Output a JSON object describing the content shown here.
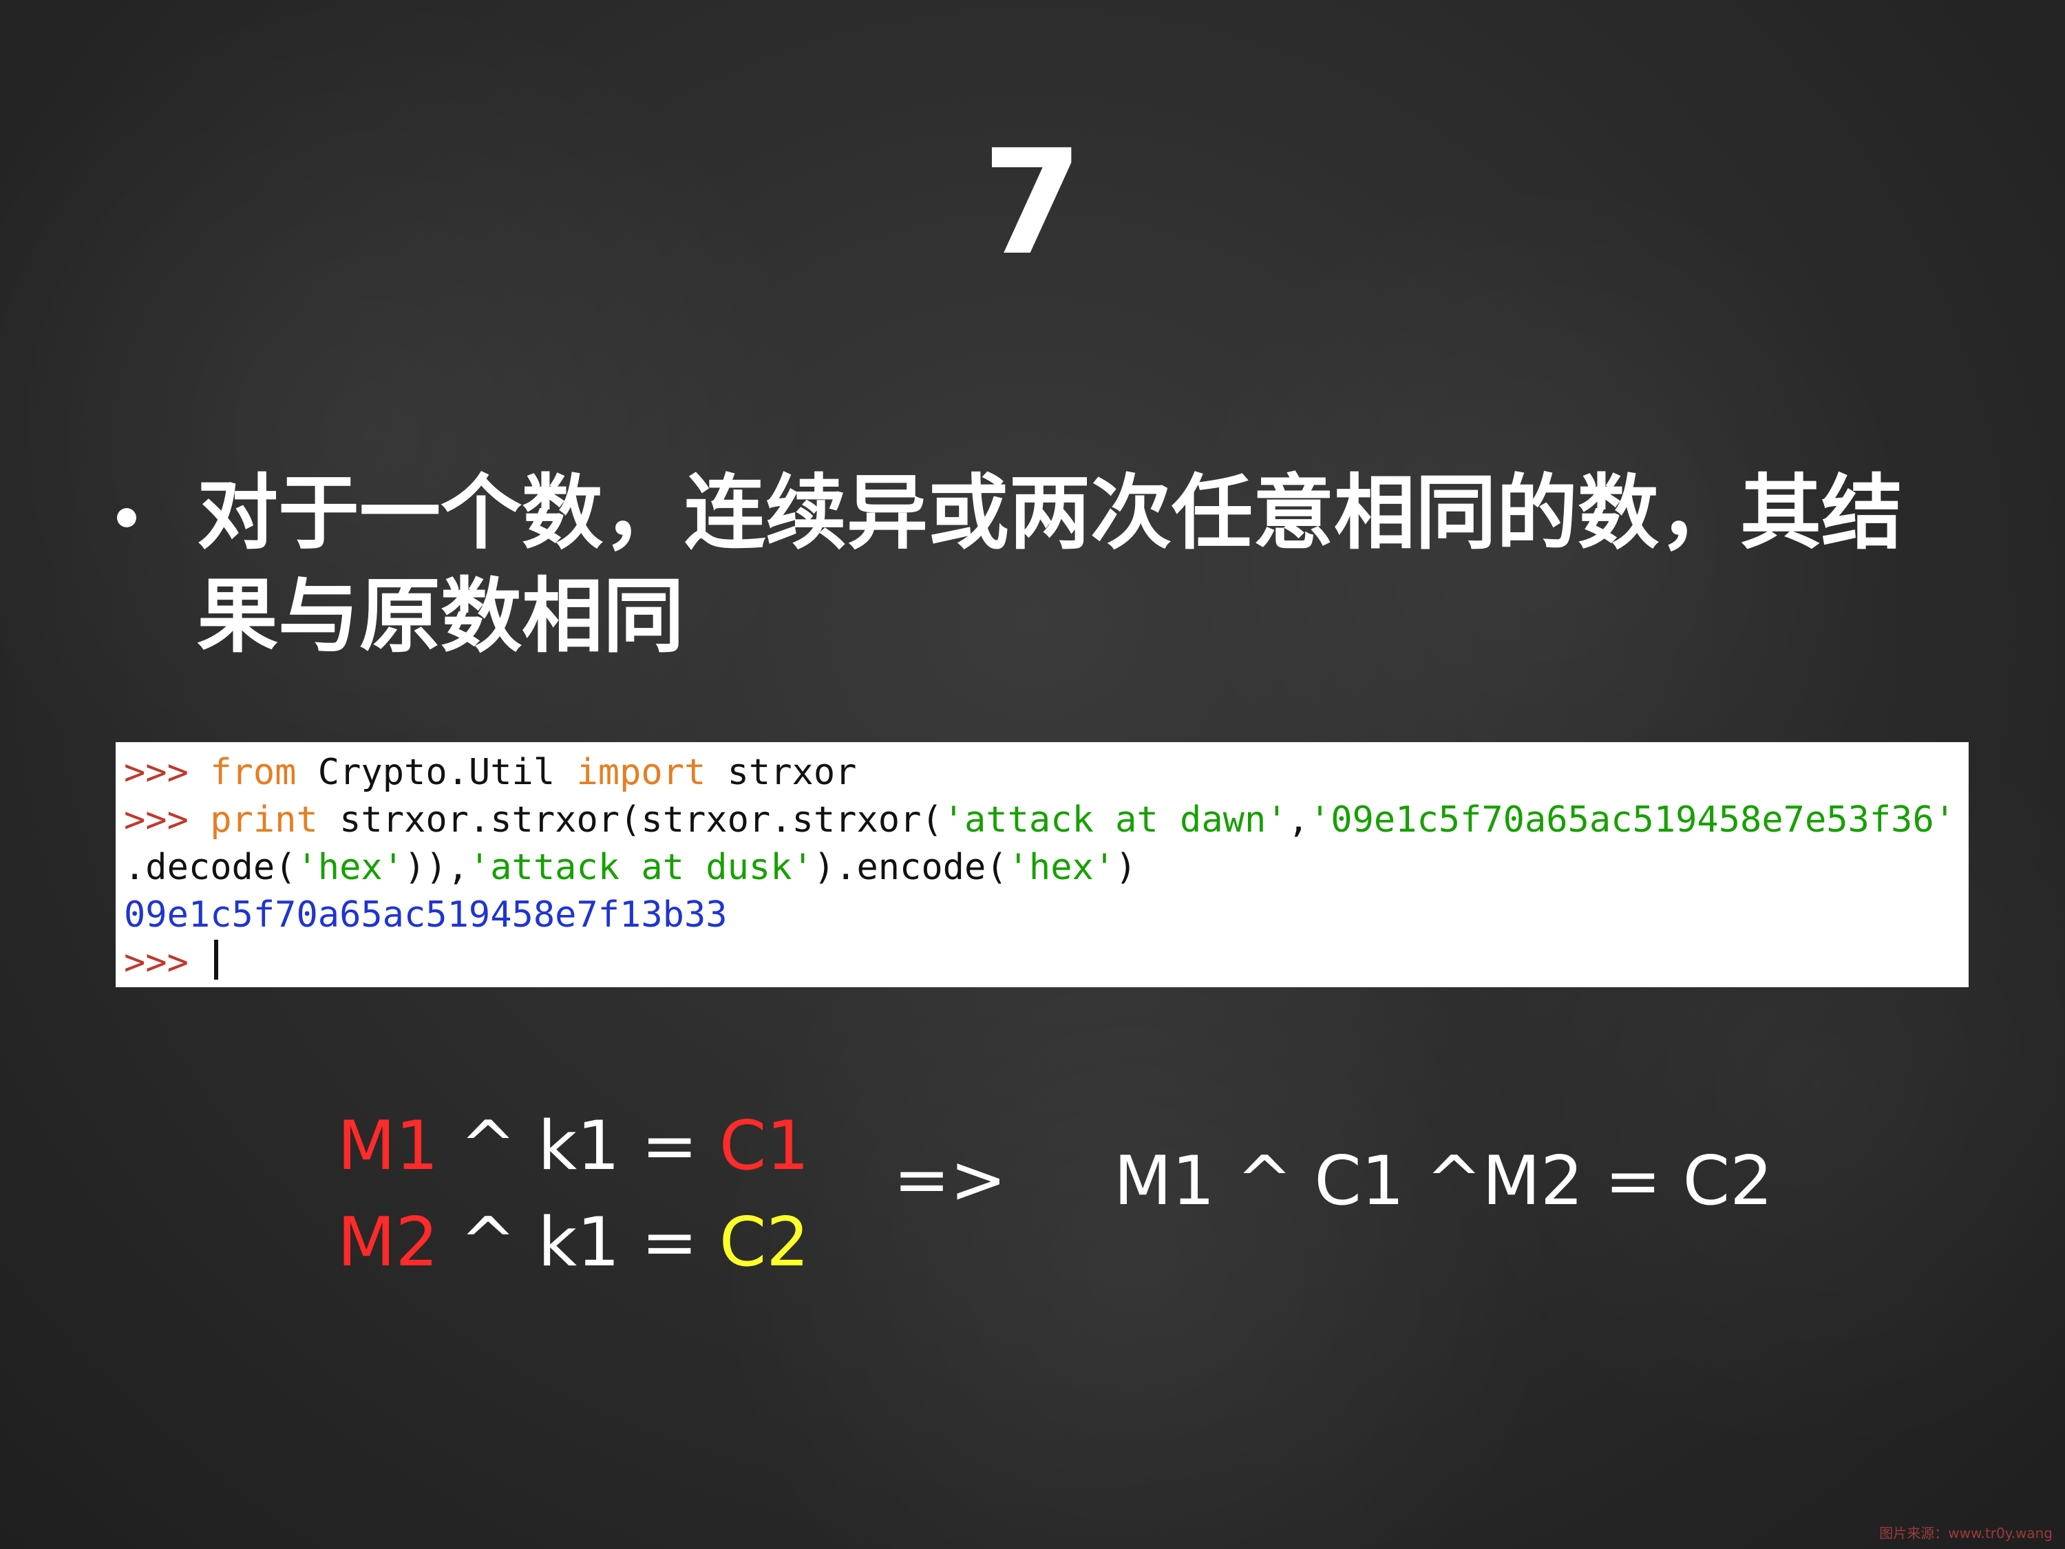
{
  "slide": {
    "title": "7",
    "bullet": "对于一个数，连续异或两次任意相同的数，其结果与原数相同"
  },
  "code": {
    "prompt": ">>>",
    "line1": {
      "from": "from",
      "module": "Crypto.Util",
      "import": "import",
      "name": "strxor"
    },
    "line2": {
      "print": "print",
      "call": "strxor.strxor(strxor.strxor(",
      "str1": "'attack at dawn'",
      "comma": ",",
      "str2": "'09e1c5f70a65ac519458e7e53f36'"
    },
    "line3": {
      "decode": ".decode(",
      "hex1": "'hex'",
      "close1": ")),",
      "str3": "'attack at dusk'",
      "encode": ").encode(",
      "hex2": "'hex'",
      "close2": ")"
    },
    "output": "09e1c5f70a65ac519458e7f13b33"
  },
  "formula": {
    "row1": {
      "m": "M1",
      "mid": " ^ k1 = ",
      "c": "C1"
    },
    "row2": {
      "m": "M2",
      "mid": " ^ k1 = ",
      "c": "C2"
    },
    "arrow": "=>",
    "result": "M1 ^ C1 ^M2 = C2"
  },
  "colors": {
    "background": "#2d2d2d",
    "red": "#ff2a2a",
    "yellow": "#ffff2a",
    "code_green": "#17a000",
    "code_orange": "#e67e22",
    "code_blue": "#1f35d1"
  },
  "watermark": "图片来源：www.tr0y.wang"
}
